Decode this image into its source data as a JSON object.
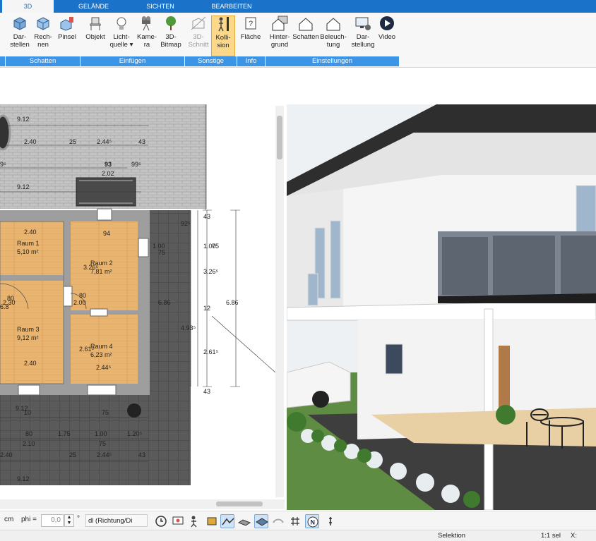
{
  "tabs": [
    {
      "label": "3D",
      "active": true
    },
    {
      "label": "GELÄNDE",
      "active": false
    },
    {
      "label": "SICHTEN",
      "active": false
    },
    {
      "label": "BEARBEITEN",
      "active": false
    }
  ],
  "ribbon": {
    "buttons": {
      "darstellen": "Dar-\nstellen",
      "rechnen": "Rech-\nnen",
      "pinsel": "Pinsel",
      "objekt": "Objekt",
      "lichtquelle": "Licht-\nquelle ▾",
      "kamera": "Kame-\nra",
      "bitmap": "3D-\nBitmap",
      "schnitt": "3D-\nSchnitt",
      "kollision": "Kolli-\nsion",
      "flaeche": "Fläche",
      "hintergrund": "Hinter-\ngrund",
      "schatten": "Schatten",
      "beleuchtung": "Beleuch-\ntung",
      "darstellung": "Dar-\nstellung",
      "video": "Video"
    },
    "groups": {
      "schatten": "Schatten",
      "einfuegen": "Einfügen",
      "sonstige": "Sonstige",
      "info": "Info",
      "einstellungen": "Einstellungen"
    }
  },
  "plan": {
    "dims": {
      "d912a": "9.12",
      "d240a": "2.40",
      "d25a": "25",
      "d244a": "2.44⁵",
      "d43a": "43",
      "d99l": "9⁵",
      "d93": "93",
      "d202": "2.02",
      "d99r": "99⁵",
      "d912b": "9.12",
      "d240b": "2.40",
      "d94": "94",
      "d262": "2.62",
      "d100a": "1.00",
      "d75a": "75",
      "d100b": "1.00",
      "d75b": "75",
      "d326": "3.26⁵",
      "d12": "12",
      "d261": "2.61⁵",
      "d43b": "43",
      "d686a": "6.86",
      "d686b": "6.86",
      "d493": "4.93⁵",
      "d92": "92⁵",
      "d43c": "43",
      "d80a": "80",
      "d230": "2.30",
      "d80b": "80",
      "d200": "2.00",
      "d240c": "2.40",
      "d244b": "2.44⁵",
      "d261b": "2.61⁵",
      "d912c": "9.12",
      "d75c": "75",
      "d80c": "80",
      "d210": "2.10",
      "d175": "1.75",
      "d100c": "1.00",
      "d75d": "75",
      "d120": "1.20⁵",
      "d240d": "2.40",
      "d25b": "25",
      "d244c": "2.44⁵",
      "d43d": "43",
      "d912d": "9.12",
      "d68": "6.8",
      "d10": "10",
      "d326b": "3.26⁵",
      "d100d": "1.00",
      "d100e": "1.00"
    },
    "rooms": [
      {
        "name": "Raum 1",
        "area": "5,10 m²"
      },
      {
        "name": "Raum 2",
        "area": "7,81 m²"
      },
      {
        "name": "Raum 3",
        "area": "9,12 m²"
      },
      {
        "name": "Raum 4",
        "area": "6,23 m²"
      }
    ]
  },
  "inputbar": {
    "unit": "cm",
    "phi_label": "phi =",
    "phi_value": "0,0",
    "deg": "°",
    "mode_value": "dl (Richtung/Di"
  },
  "status": {
    "mode": "Selektion",
    "scale": "1:1 sel",
    "x_label": "X:"
  },
  "colors": {
    "accent": "#1b73c9",
    "group": "#3c94e6",
    "active_button": "#fbd88a",
    "wood": "#e8b46f",
    "paving": "#bdbdbd",
    "terrace": "#585858"
  }
}
